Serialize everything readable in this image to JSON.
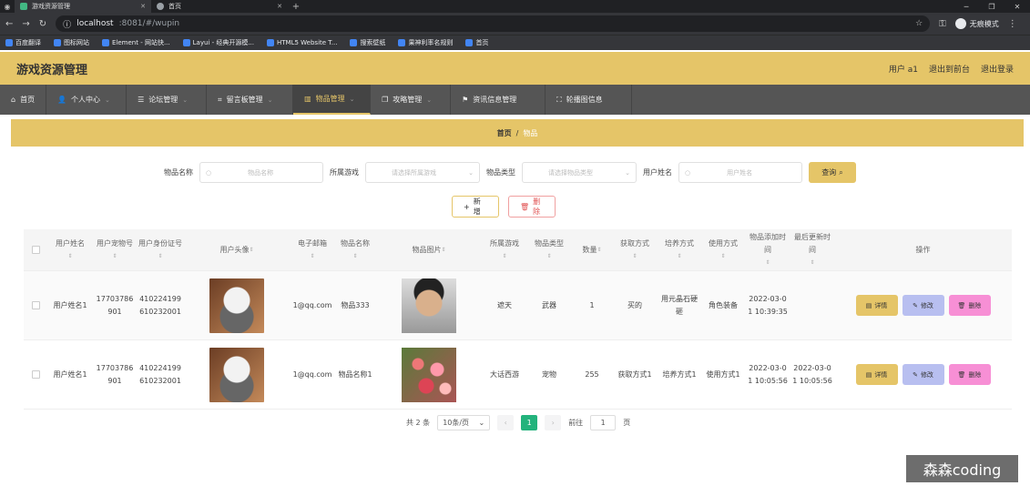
{
  "browser": {
    "tabs": [
      {
        "title": "游戏资源管理"
      },
      {
        "title": "首页"
      }
    ],
    "url_host": "localhost",
    "url_path": ":8081/#/wupin",
    "incognito_label": "无痕模式",
    "bookmarks": [
      "百度翻译",
      "图标网站",
      "Element - 网站快...",
      "Layui - 经典开源模...",
      "HTML5 Website T...",
      "搜索壁纸",
      "果神利率名规则",
      "首页"
    ]
  },
  "app": {
    "title": "游戏资源管理",
    "user_label": "用户 a1",
    "to_frontend": "退出到前台",
    "logout": "退出登录"
  },
  "nav": {
    "items": [
      {
        "label": "首页",
        "icon": "home-icon"
      },
      {
        "label": "个人中心",
        "icon": "user-icon"
      },
      {
        "label": "论坛管理",
        "icon": "list-icon"
      },
      {
        "label": "留言板管理",
        "icon": "crop-icon"
      },
      {
        "label": "物品管理",
        "icon": "chart-icon"
      },
      {
        "label": "攻略管理",
        "icon": "copy-icon"
      },
      {
        "label": "资讯信息管理",
        "icon": "flag-icon"
      },
      {
        "label": "轮播图信息",
        "icon": "scan-icon"
      }
    ]
  },
  "breadcrumb": {
    "home": "首页",
    "sep": "/",
    "current": "物品"
  },
  "search": {
    "item_name_label": "物品名称",
    "item_name_placeholder": "物品名称",
    "game_label": "所属游戏",
    "game_placeholder": "请选择所属游戏",
    "type_label": "物品类型",
    "type_placeholder": "请选择物品类型",
    "user_label": "用户姓名",
    "user_placeholder": "用户姓名",
    "search_button": "查询"
  },
  "actions": {
    "add": "新增",
    "delete": "删除"
  },
  "table": {
    "headers": [
      "用户姓名",
      "用户宠物号",
      "用户身份证号",
      "用户头像",
      "电子邮箱",
      "物品名称",
      "物品图片",
      "所属游戏",
      "物品类型",
      "数量",
      "获取方式",
      "培养方式",
      "使用方式",
      "物品添加时间",
      "最后更新时间",
      "操作"
    ],
    "rows": [
      {
        "user_name": "用户姓名1",
        "pet_no": "17703786901",
        "id_no": "410224199610232001",
        "email": "1@qq.com",
        "item_name": "物品333",
        "game": "遮天",
        "type": "武器",
        "count": "1",
        "obtain": "买的",
        "cultivate": "用元晶石硬砸",
        "use": "角色装备",
        "added": "2022-03-01 10:39:35",
        "updated": ""
      },
      {
        "user_name": "用户姓名1",
        "pet_no": "17703786901",
        "id_no": "410224199610232001",
        "email": "1@qq.com",
        "item_name": "物品名称1",
        "game": "大话西游",
        "type": "宠物",
        "count": "255",
        "obtain": "获取方式1",
        "cultivate": "培养方式1",
        "use": "使用方式1",
        "added": "2022-03-01 10:05:56",
        "updated": "2022-03-01 10:05:56"
      }
    ],
    "op_detail": "详情",
    "op_edit": "修改",
    "op_delete": "删除"
  },
  "pagination": {
    "total": "共 2 条",
    "page_size": "10条/页",
    "current_page": "1",
    "goto_label": "前往",
    "goto_value": "1",
    "page_suffix": "页"
  },
  "watermark": "森森coding",
  "colors": {
    "accent": "#e5c568",
    "nav": "#555555",
    "page_active": "#23b37c"
  }
}
